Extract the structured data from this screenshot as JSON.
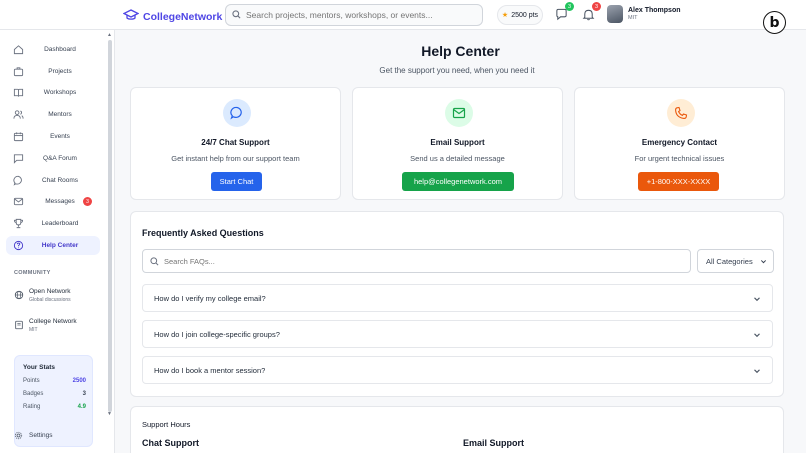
{
  "header": {
    "app_name": "CollegeNetwork",
    "search_placeholder": "Search projects, mentors, workshops, or events...",
    "points": "2500 pts",
    "chat_badge": "3",
    "notif_badge": "3",
    "user_name": "Alex Thompson",
    "user_org": "MIT"
  },
  "sidebar": {
    "items": [
      {
        "label": "Dashboard"
      },
      {
        "label": "Projects"
      },
      {
        "label": "Workshops"
      },
      {
        "label": "Mentors"
      },
      {
        "label": "Events"
      },
      {
        "label": "Q&A Forum"
      },
      {
        "label": "Chat Rooms"
      },
      {
        "label": "Messages",
        "badge": "3"
      },
      {
        "label": "Leaderboard"
      },
      {
        "label": "Help Center"
      }
    ],
    "community_heading": "COMMUNITY",
    "community": [
      {
        "title": "Open Network",
        "subtitle": "Global discussions"
      },
      {
        "title": "College Network",
        "subtitle": "MIT"
      }
    ],
    "stats": {
      "heading": "Your Stats",
      "rows": [
        {
          "label": "Points",
          "value": "2500",
          "color": "#4f46e5"
        },
        {
          "label": "Badges",
          "value": "3",
          "color": "#374151"
        },
        {
          "label": "Rating",
          "value": "4.9",
          "color": "#16a34a"
        }
      ]
    },
    "settings_label": "Settings"
  },
  "main": {
    "title": "Help Center",
    "subtitle": "Get the support you need, when you need it",
    "cards": [
      {
        "title": "24/7 Chat Support",
        "desc": "Get instant help from our support team",
        "button": "Start Chat",
        "accent": "#2563eb",
        "icon": "chat-bubble-icon"
      },
      {
        "title": "Email Support",
        "desc": "Send us a detailed message",
        "button": "help@collegenetwork.com",
        "accent": "#16a34a",
        "icon": "mail-icon"
      },
      {
        "title": "Emergency Contact",
        "desc": "For urgent technical issues",
        "button": "+1-800-XXX-XXXX",
        "accent": "#ea580c",
        "icon": "phone-icon"
      }
    ],
    "faq": {
      "heading": "Frequently Asked Questions",
      "search_placeholder": "Search FAQs...",
      "category": "All Categories",
      "items": [
        {
          "q": "How do I verify my college email?"
        },
        {
          "q": "How do I join college-specific groups?"
        },
        {
          "q": "How do I book a mentor session?"
        }
      ]
    },
    "hours": {
      "heading": "Support Hours",
      "col1": "Chat Support",
      "col2": "Email Support"
    }
  }
}
